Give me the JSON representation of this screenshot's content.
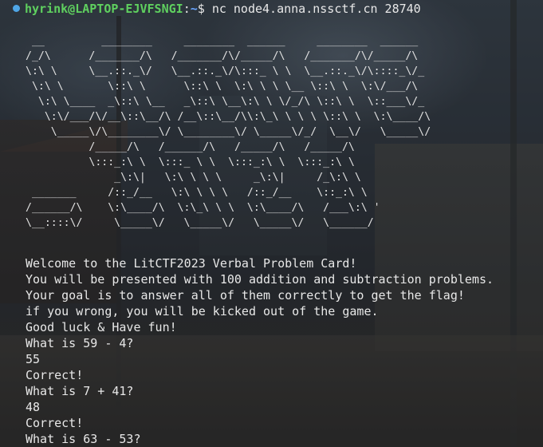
{
  "prompt": {
    "user_host": "hyrink@LAPTOP-EJVFSNGI",
    "separator": ":",
    "path": "~",
    "symbol": "$",
    "command": "nc node4.anna.nssctf.cn 28740"
  },
  "banner": {
    "ascii_art": " __         ________     ________  ______     ________  ______\n/_/\\      /_______/\\   /_______/\\/_____/\\   /_______/\\/_____/\\\n\\:\\ \\     \\__.::._\\/   \\__.::._\\/\\:::_ \\ \\  \\__.::._\\/\\::::_\\/_\n \\:\\ \\       \\::\\ \\      \\::\\ \\  \\:\\ \\ \\ \\__ \\::\\ \\  \\:\\/___/\\\n  \\:\\ \\____  _\\::\\ \\__   _\\::\\ \\__\\:\\ \\ \\/_/\\ \\::\\ \\  \\::___\\/_\n   \\:\\/___/\\/__\\::\\__/\\ /__\\::\\__/\\\\:\\_\\ \\ \\ \\ \\::\\ \\  \\:\\____/\\\n    \\_____\\/\\________\\/ \\________\\/ \\_____\\/_/  \\__\\/   \\_____\\/\n          /_____/\\   /______/\\   /_____/\\   /_____/\\\n          \\:::_:\\ \\  \\:::_ \\ \\  \\:::_:\\ \\  \\:::_:\\ \\\n              _\\:\\|   \\:\\ \\ \\ \\     _\\:\\|     /_\\:\\ \\\n _______     /::_/__   \\:\\ \\ \\ \\   /::_/__    \\::_:\\ \\\n/______/\\    \\:\\____/\\  \\:\\_\\ \\ \\  \\:\\____/\\   /___\\:\\ '\n\\__::::\\/     \\_____\\/   \\_____\\/   \\_____\\/   \\______/"
  },
  "output_lines": [
    "Welcome to the LitCTF2023 Verbal Problem Card!",
    "You will be presented with 100 addition and subtraction problems.",
    "Your goal is to answer all of them correctly to get the flag!",
    "if you wrong, you will be kicked out of the game.",
    "Good luck & Have fun!",
    "What is 59 - 4?",
    "55",
    "Correct!",
    "What is 7 + 41?",
    "48",
    "Correct!",
    "What is 63 - 53?"
  ],
  "colors": {
    "user_host": "#5fd05f",
    "path": "#6aa6ff",
    "status_dot": "#4fa6e6",
    "text": "#e8e8e8"
  },
  "icons": {
    "status_dot": "status-dot-icon"
  }
}
